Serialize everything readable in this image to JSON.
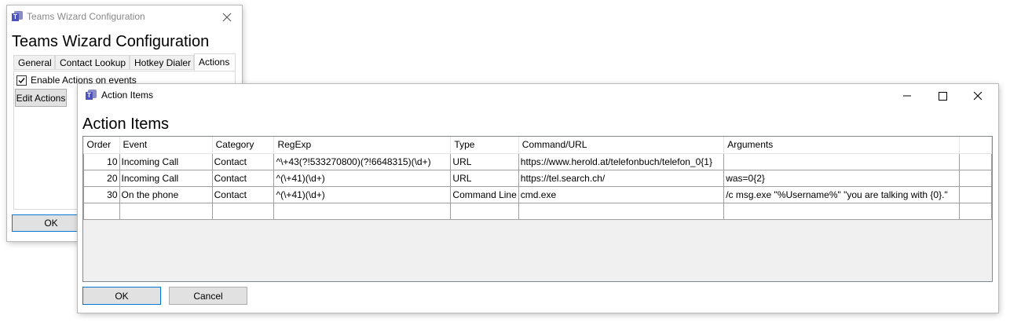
{
  "wizard": {
    "title": "Teams Wizard Configuration",
    "heading": "Teams Wizard Configuration",
    "tabs": [
      "General",
      "Contact Lookup",
      "Hotkey Dialer",
      "Actions"
    ],
    "enable_actions_label": "Enable Actions on events",
    "enable_actions_checked": true,
    "edit_actions_label": "Edit Actions",
    "ok_label": "OK"
  },
  "action_items": {
    "title": "Action Items",
    "heading": "Action Items",
    "columns": [
      "Order",
      "Event",
      "Category",
      "RegExp",
      "Type",
      "Command/URL",
      "Arguments"
    ],
    "rows": [
      [
        "10",
        "Incoming Call",
        "Contact",
        "^\\+43(?!533270800)(?!6648315)(\\d+)",
        "URL",
        "https://www.herold.at/telefonbuch/telefon_0{1}",
        ""
      ],
      [
        "20",
        "Incoming Call",
        "Contact",
        "^(\\+41)(\\d+)",
        "URL",
        "https://tel.search.ch/",
        "was=0{2}"
      ],
      [
        "30",
        "On the phone",
        "Contact",
        "^(\\+41)(\\d+)",
        "Command Line",
        "cmd.exe",
        "/c msg.exe \"%Username%\" \"you are talking with {0}.\""
      ],
      [
        "",
        "",
        "",
        "",
        "",
        "",
        ""
      ]
    ],
    "ok_label": "OK",
    "cancel_label": "Cancel"
  },
  "colors": {
    "accent": "#0078d7",
    "button": "#e1e1e1",
    "grid_bg": "#f0f0f0"
  }
}
